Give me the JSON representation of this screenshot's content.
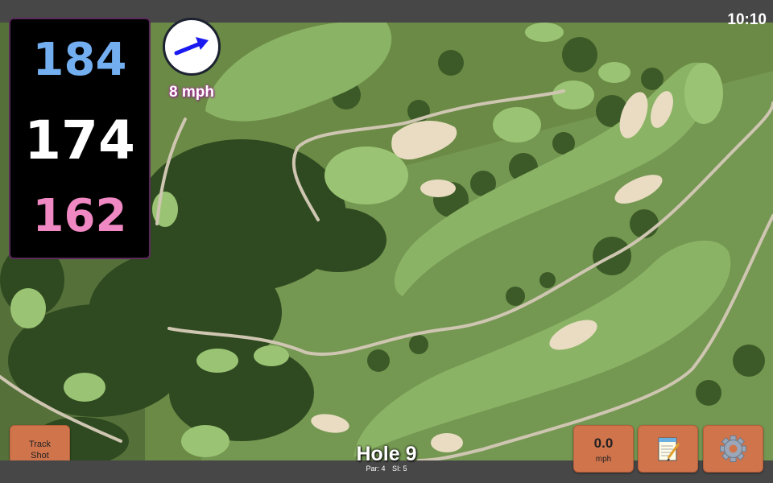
{
  "status": {
    "clock": "10:10"
  },
  "distances": {
    "back": "184",
    "middle": "174",
    "front": "162"
  },
  "wind": {
    "speed_label": "8 mph",
    "icon": "wind-arrow-icon",
    "direction": "east-northeast"
  },
  "buttons": {
    "track_shot": {
      "line1": "Track",
      "line2": "Shot"
    },
    "speed": {
      "value": "0.0",
      "unit": "mph"
    },
    "notes": {
      "icon": "notepad-icon"
    },
    "settings": {
      "icon": "gear-icon"
    }
  },
  "hole": {
    "title": "Hole 9",
    "par": "Par: 4",
    "si": "SI: 5"
  },
  "colors": {
    "back_distance": "#72aef0",
    "middle_distance": "#ffffff",
    "front_distance": "#f089c3",
    "button": "#d0744c",
    "wind_label_glow": "#b03aa0"
  }
}
